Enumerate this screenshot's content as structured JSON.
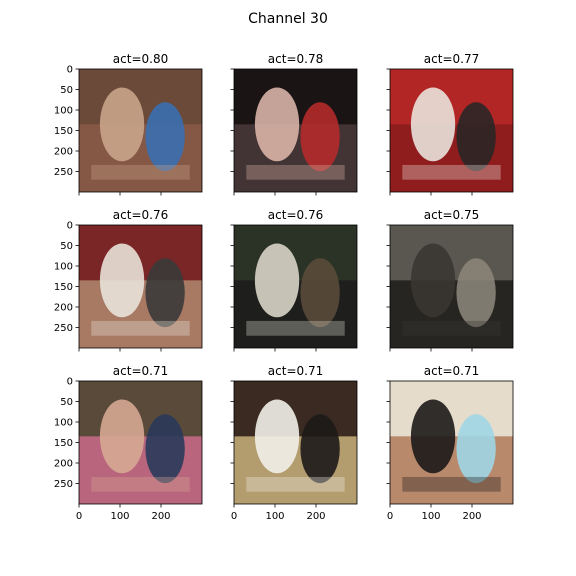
{
  "title": "Channel 30",
  "chart_data": {
    "type": "image-grid",
    "rows": 3,
    "cols": 3,
    "axis_ticks": [
      0,
      50,
      100,
      150,
      200,
      250
    ],
    "x_ticks": [
      0,
      100,
      200
    ],
    "x_range": [
      0,
      300
    ],
    "y_range": [
      0,
      300
    ],
    "y_inverted": true,
    "panels": [
      {
        "title": "act=0.80",
        "act": 0.8,
        "colors": [
          "#6b4a3a",
          "#c9a48a",
          "#3a6fb0",
          "#8a5a48"
        ]
      },
      {
        "title": "act=0.78",
        "act": 0.78,
        "colors": [
          "#1a1414",
          "#d9b3a6",
          "#b52a2a",
          "#4a3a3a"
        ]
      },
      {
        "title": "act=0.77",
        "act": 0.77,
        "colors": [
          "#b32626",
          "#e9e3dc",
          "#2a2626",
          "#8a1c1c"
        ]
      },
      {
        "title": "act=0.76",
        "act": 0.76,
        "colors": [
          "#7a2626",
          "#e8e2d8",
          "#3a3a3a",
          "#b08a70"
        ]
      },
      {
        "title": "act=0.76",
        "act": 0.76,
        "colors": [
          "#2a3326",
          "#d8d4c8",
          "#5a4a3a",
          "#1c1c1c"
        ]
      },
      {
        "title": "act=0.75",
        "act": 0.75,
        "colors": [
          "#5a5650",
          "#3a3632",
          "#8a8478",
          "#1e1c1a"
        ]
      },
      {
        "title": "act=0.71",
        "act": 0.71,
        "colors": [
          "#5a4a3a",
          "#d6a892",
          "#2a3a5a",
          "#c96a8a"
        ]
      },
      {
        "title": "act=0.71",
        "act": 0.71,
        "colors": [
          "#3a2a22",
          "#f1efe8",
          "#1c1a18",
          "#c9b07a"
        ]
      },
      {
        "title": "act=0.71",
        "act": 0.71,
        "colors": [
          "#e6dccc",
          "#1c1a1a",
          "#9ed6e6",
          "#b07a5a"
        ]
      }
    ]
  }
}
